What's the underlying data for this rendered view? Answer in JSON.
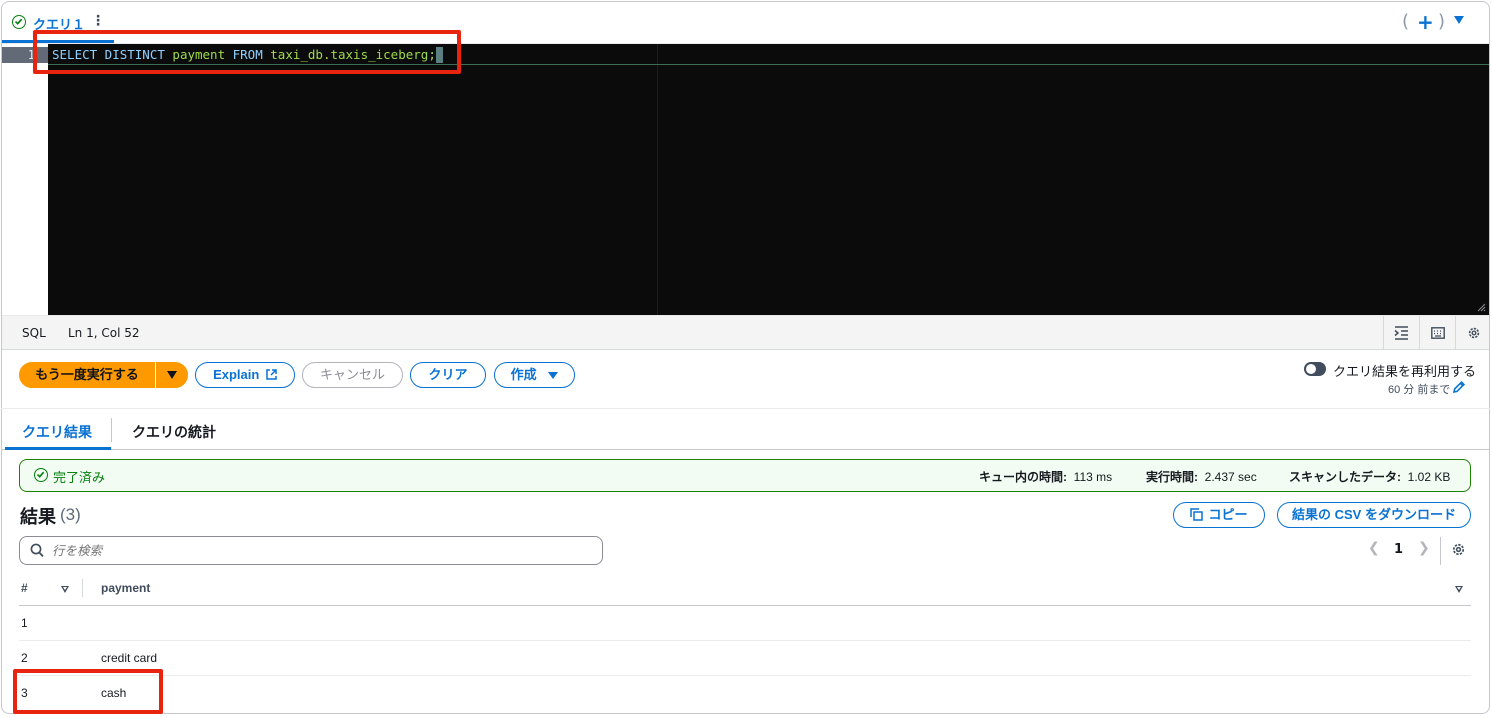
{
  "query_tab": {
    "label": "クエリ１",
    "status_icon": "check-circle-icon",
    "menu_icon": "kebab-icon"
  },
  "tab_actions": {
    "add_label": "+",
    "open_paren": "(",
    "close_paren": ")"
  },
  "editor": {
    "line_number": "1",
    "code": "SELECT DISTINCT payment FROM taxi_db.taxis_iceberg;",
    "tokens": [
      {
        "text": "SELECT DISTINCT",
        "kind": "kw"
      },
      {
        "text": " payment",
        "kind": "id"
      },
      {
        "text": " FROM",
        "kind": "kw"
      },
      {
        "text": " taxi_db.taxis_iceberg;",
        "kind": "id"
      }
    ]
  },
  "statusbar": {
    "language": "SQL",
    "position": "Ln 1, Col 52"
  },
  "actions": {
    "run_again": "もう一度実行する",
    "explain": "Explain",
    "cancel": "キャンセル",
    "clear": "クリア",
    "create": "作成"
  },
  "reuse": {
    "label": "クエリ結果を再利用する",
    "sub": "60 分 前まで"
  },
  "result_tabs": {
    "results": "クエリ結果",
    "stats": "クエリの統計"
  },
  "banner": {
    "status": "完了済み",
    "queue_label": "キュー内の時間:",
    "queue_value": "113 ms",
    "exec_label": "実行時間:",
    "exec_value": "2.437 sec",
    "scan_label": "スキャンしたデータ:",
    "scan_value": "1.02 KB"
  },
  "results": {
    "title": "結果",
    "count": "(3)",
    "copy": "コピー",
    "download": "結果の CSV をダウンロード",
    "search_placeholder": "行を検索",
    "page": "1",
    "columns": [
      "#",
      "payment"
    ],
    "rows": [
      {
        "idx": "1",
        "payment": ""
      },
      {
        "idx": "2",
        "payment": "credit card"
      },
      {
        "idx": "3",
        "payment": "cash"
      }
    ]
  },
  "colors": {
    "accent": "#0972d3",
    "primary": "#ff9900",
    "success": "#037f0c",
    "highlight": "#e8240f"
  }
}
